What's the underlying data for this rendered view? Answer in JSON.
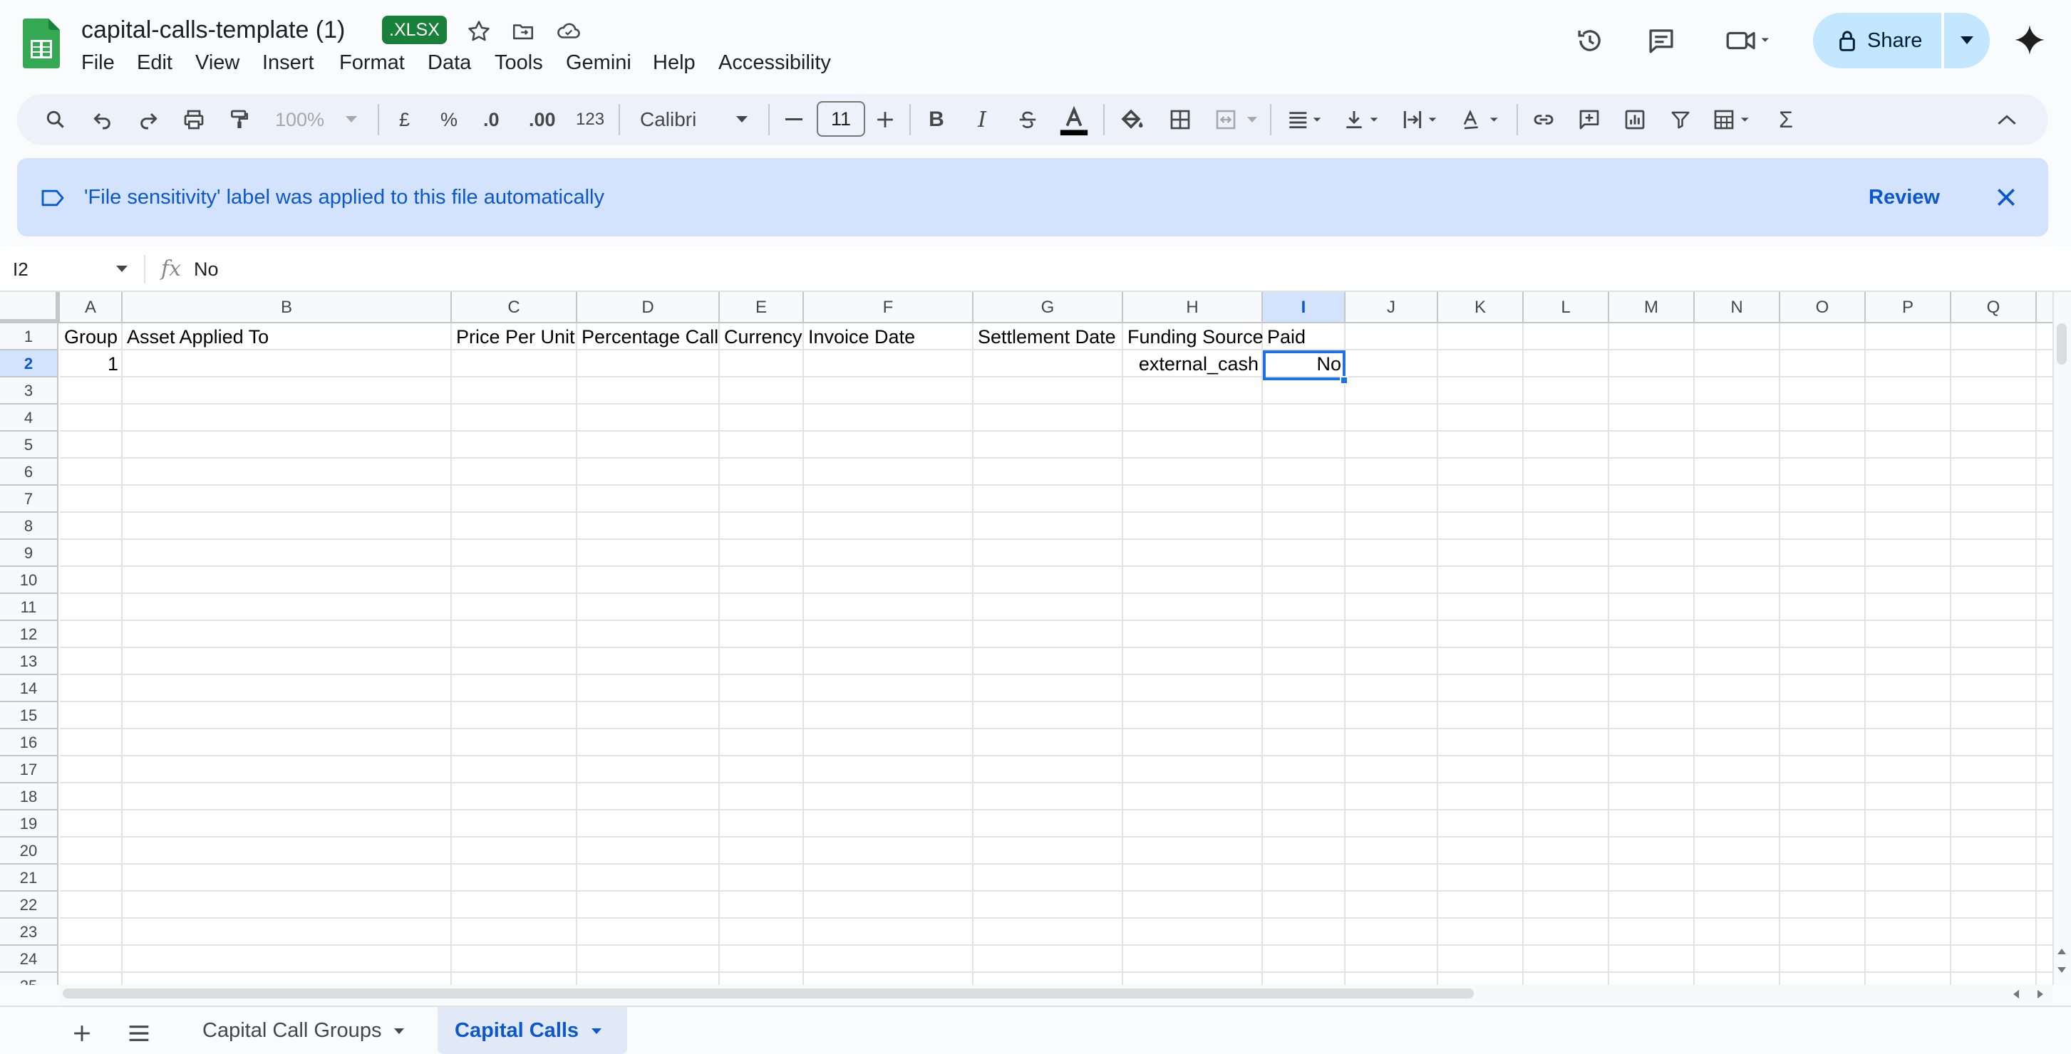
{
  "app": {
    "doc_title": "capital-calls-template (1)",
    "file_badge": ".XLSX",
    "accent": "#0b57d0",
    "brand_green": "#188038"
  },
  "menu": [
    "File",
    "Edit",
    "View",
    "Insert",
    "Format",
    "Data",
    "Tools",
    "Gemini",
    "Help",
    "Accessibility"
  ],
  "header_actions": {
    "share_label": "Share",
    "icons": [
      "history-icon",
      "comment-icon",
      "meet-icon",
      "gemini-icon"
    ]
  },
  "toolbar": {
    "zoom": "100%",
    "currency": "£",
    "percent": "%",
    "decrease_decimals": ".0",
    "increase_decimals": ".00",
    "number_format": "123",
    "font": "Calibri",
    "font_size": "11"
  },
  "banner": {
    "text": "'File sensitivity' label was applied to this file automatically",
    "action": "Review"
  },
  "formula_bar": {
    "cell_ref": "I2",
    "fx": "fx",
    "value": "No"
  },
  "grid": {
    "columns": [
      "A",
      "B",
      "C",
      "D",
      "E",
      "F",
      "G",
      "H",
      "I",
      "J",
      "K",
      "L",
      "M",
      "N",
      "O",
      "P",
      "Q"
    ],
    "rows": [
      "1",
      "2",
      "3",
      "4",
      "5",
      "6",
      "7",
      "8",
      "9",
      "10",
      "11",
      "12",
      "13",
      "14",
      "15",
      "16",
      "17",
      "18",
      "19",
      "20",
      "21",
      "22",
      "23",
      "24",
      "25"
    ],
    "selected_column": "I",
    "selected_row": "2",
    "header_row": [
      "Group",
      "Asset Applied To",
      "Price Per Unit",
      "Percentage Call",
      "Currency",
      "Invoice Date",
      "Settlement Date",
      "Funding Source",
      "Paid"
    ],
    "data_row": {
      "group": "1",
      "funding_source": "external_cash",
      "paid": "No"
    }
  },
  "sheets": {
    "tabs": [
      "Capital Call Groups",
      "Capital Calls"
    ],
    "active": "Capital Calls"
  }
}
